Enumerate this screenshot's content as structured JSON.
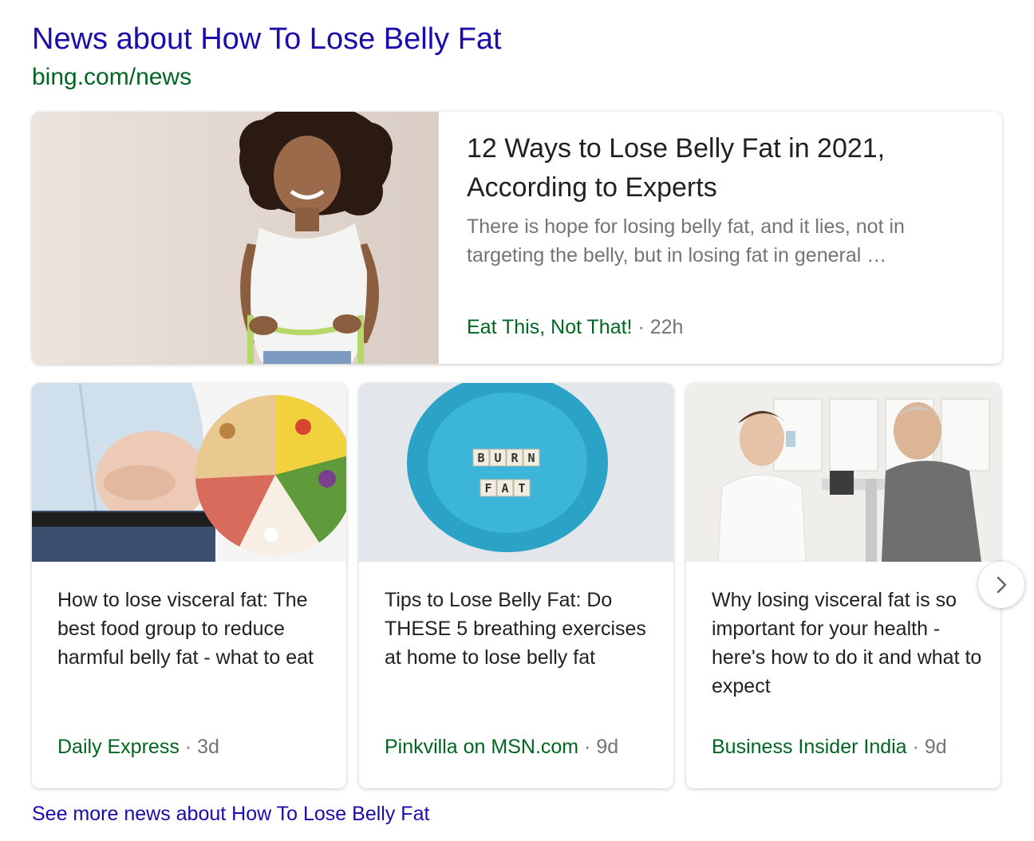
{
  "news_block": {
    "title": "News about How To Lose Belly Fat",
    "source_url": "bing.com/news",
    "featured": {
      "headline": "12 Ways to Lose Belly Fat in 2021, According to Experts",
      "snippet": "There is hope for losing belly fat, and it lies, not in targeting the belly, but in losing fat in general …",
      "publisher": "Eat This, Not That!",
      "age": "22h",
      "image": "woman-measuring-waist-image"
    },
    "cards": [
      {
        "headline": "How to lose visceral fat: The best food group to reduce harmful belly fat - what to eat",
        "publisher": "Daily Express",
        "age": "3d",
        "image": "belly-and-food-groups-image"
      },
      {
        "headline": "Tips to Lose Belly Fat: Do THESE 5 breathing exercises at home to lose belly fat",
        "publisher": "Pinkvilla on MSN.com",
        "age": "9d",
        "image": "burn-fat-plate-image",
        "tile_words": [
          "BURN",
          "FAT"
        ]
      },
      {
        "headline": "Why losing visceral fat is so important for your health - here's how to do it and what to expect",
        "publisher": "Business Insider India",
        "age": "9d",
        "image": "doctor-weighing-patient-image"
      }
    ],
    "separator": "·",
    "next_icon": "chevron-right-icon",
    "see_more": "See more news about How To Lose Belly Fat",
    "colors": {
      "link": "#1a0dab",
      "url_green": "#006621",
      "headline": "#202124",
      "muted": "#70757a",
      "plate_blue": "#3bb5d8"
    }
  }
}
